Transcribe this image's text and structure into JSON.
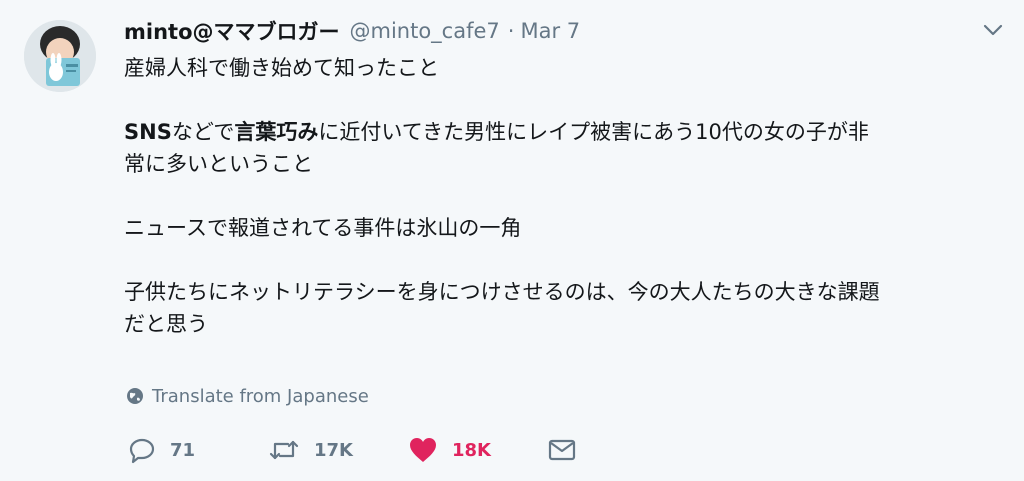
{
  "tweet": {
    "display_name": "minto@ママブロガー",
    "handle": "@minto_cafe7",
    "separator": "·",
    "date": "Mar 7",
    "lines": {
      "l1": "産婦人科で働き始めて知ったこと",
      "l2_bold1": "SNS",
      "l2_a": "などで",
      "l2_bold2": "言葉巧み",
      "l2_b": "に近付いてきた男性にレイプ被害にあう10代の女の子が非",
      "l3": "常に多いということ",
      "l4": "ニュースで報道されてる事件は氷山の一角",
      "l5": "子供たちにネットリテラシーを身につけさせるのは、今の大人たちの大きな課題",
      "l6": "だと思う"
    },
    "translate_label": "Translate from Japanese",
    "counts": {
      "replies": "71",
      "retweets": "17K",
      "likes": "18K"
    },
    "icons": {
      "avatar": "avatar",
      "menu": "chevron-down-icon",
      "translate": "globe-icon",
      "reply": "reply-icon",
      "retweet": "retweet-icon",
      "like": "heart-icon",
      "dm": "envelope-icon"
    },
    "colors": {
      "background": "#f5f8fa",
      "text": "#14171a",
      "muted": "#657786",
      "like": "#e0245e"
    }
  }
}
